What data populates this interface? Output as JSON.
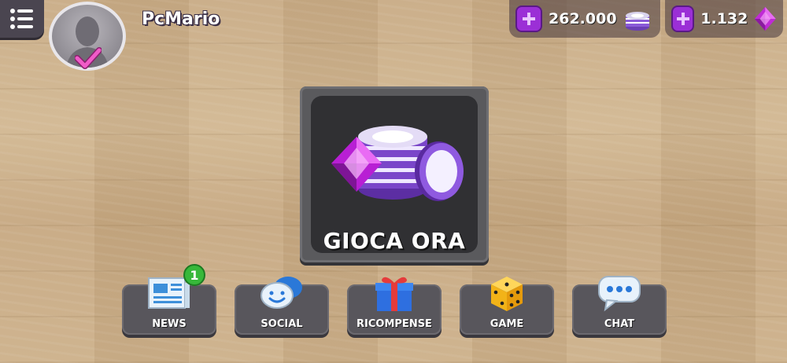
{
  "player": {
    "name": "PcMario"
  },
  "currency": {
    "chips": {
      "value": "262.000"
    },
    "gems": {
      "value": "1.132"
    }
  },
  "play_button": {
    "label": "GIOCA ORA"
  },
  "bottom_menu": [
    {
      "id": "news",
      "label": "NEWS",
      "badge": "1"
    },
    {
      "id": "social",
      "label": "SOCIAL"
    },
    {
      "id": "ricompense",
      "label": "RICOMPENSE"
    },
    {
      "id": "game",
      "label": "GAME"
    },
    {
      "id": "chat",
      "label": "CHAT"
    }
  ],
  "colors": {
    "accent": "#9b2fd6",
    "badge": "#37b83a",
    "panel": "#58565c"
  }
}
